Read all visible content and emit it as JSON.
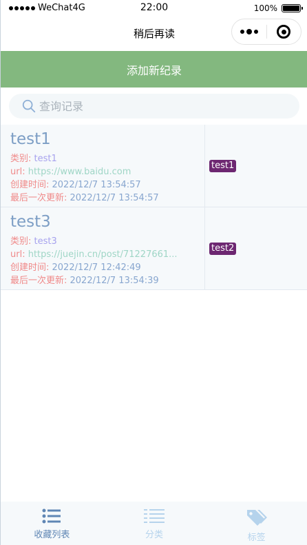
{
  "status_bar": {
    "carrier": "WeChat4G",
    "time": "22:00",
    "battery": "100%",
    "battery_level": 1.0
  },
  "nav": {
    "title": "稍后再读"
  },
  "add_button": {
    "label": "添加新纪录"
  },
  "search": {
    "placeholder": "查询记录"
  },
  "labels": {
    "category": "类别: ",
    "url": "url: ",
    "created": "创建时间: ",
    "updated": "最后一次更新: "
  },
  "records": [
    {
      "title": "test1",
      "category": "test1",
      "url": "https://www.baidu.com",
      "created": "2022/12/7 13:54:57",
      "updated": "2022/12/7 13:54:57",
      "tag": "test1"
    },
    {
      "title": "test3",
      "category": "test3",
      "url": "https://juejin.cn/post/71227661...",
      "created": "2022/12/7 12:42:49",
      "updated": "2022/12/7 13:54:39",
      "tag": "test2"
    }
  ],
  "tabs": [
    {
      "label": "收藏列表",
      "icon": "list-icon",
      "active": true
    },
    {
      "label": "分类",
      "icon": "category-list-icon",
      "active": false
    },
    {
      "label": "标签",
      "icon": "tags-icon",
      "active": false
    }
  ],
  "colors": {
    "accent_green": "#83b87f",
    "title_blue": "#7d9ec5",
    "label_red": "#f08a8a",
    "tag_purple": "#6d2771",
    "tab_active": "#5f86b4",
    "tab_inactive": "#b5d3ec"
  }
}
